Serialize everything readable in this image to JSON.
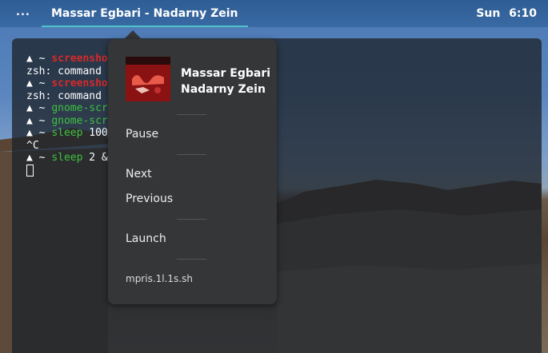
{
  "topbar": {
    "activities": "...",
    "app_title": "Massar Egbari - Nadarny Zein",
    "clock_day": "Sun",
    "clock_time": "6:10"
  },
  "terminal": {
    "lines": [
      [
        {
          "t": "▲ ~ ",
          "c": "w"
        },
        {
          "t": "screensho",
          "c": "r"
        }
      ],
      [
        {
          "t": "zsh: command",
          "c": "w"
        }
      ],
      [
        {
          "t": "▲ ~ ",
          "c": "w"
        },
        {
          "t": "screensho",
          "c": "r"
        }
      ],
      [
        {
          "t": "zsh: command",
          "c": "w"
        }
      ],
      [
        {
          "t": "▲ ~ ",
          "c": "w"
        },
        {
          "t": "gnome-scr",
          "c": "g"
        }
      ],
      [
        {
          "t": "▲ ~ ",
          "c": "w"
        },
        {
          "t": "gnome-scr",
          "c": "g"
        }
      ],
      [
        {
          "t": "▲ ~ ",
          "c": "w"
        },
        {
          "t": "sleep",
          "c": "g"
        },
        {
          "t": " 100",
          "c": "w"
        }
      ],
      [
        {
          "t": "^C",
          "c": "w"
        }
      ],
      [
        {
          "t": "▲ ~ ",
          "c": "w"
        },
        {
          "t": "sleep",
          "c": "g"
        },
        {
          "t": " 2 &",
          "c": "w"
        }
      ]
    ]
  },
  "popover": {
    "track_title_line1": "Massar Egbari",
    "track_title_line2": "Nadarny Zein",
    "pause_label": "Pause",
    "next_label": "Next",
    "previous_label": "Previous",
    "launch_label": "Launch",
    "footer": "mpris.1l.1s.sh"
  },
  "colors": {
    "topbar_bg": "#2e5d95",
    "accent": "#4fc3c9",
    "popover_bg": "#343637",
    "prompt_red": "#d62a2a",
    "prompt_green": "#3fc13f"
  }
}
